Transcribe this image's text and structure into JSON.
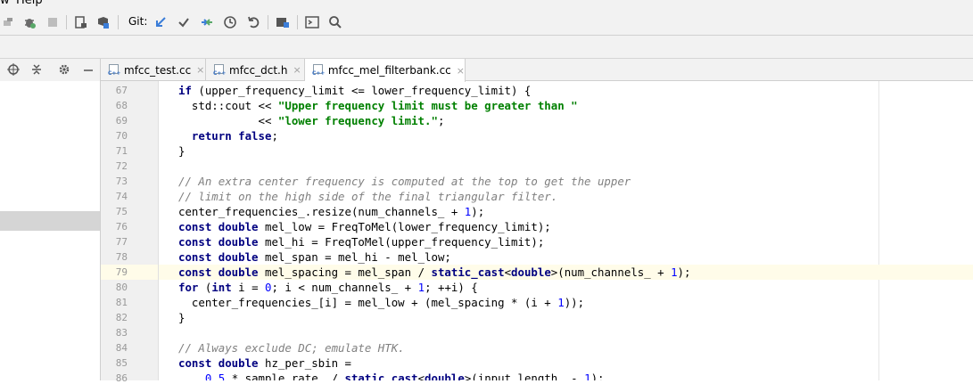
{
  "menu": {
    "view_label": "w",
    "help_label": "Help"
  },
  "toolbar": {
    "git_label": "Git:",
    "icons": [
      "build-icon",
      "debug-icon",
      "stop-icon",
      "run-coverage-icon",
      "profile-icon",
      "git-update-icon",
      "git-commit-icon",
      "git-compare-icon",
      "git-history-icon",
      "git-revert-icon",
      "project-structure-icon",
      "terminal-icon",
      "search-icon"
    ]
  },
  "tabs": [
    {
      "label": "mfcc_test.cc",
      "close": "×",
      "active": false
    },
    {
      "label": "mfcc_dct.h",
      "close": "×",
      "active": false
    },
    {
      "label": "mfcc_mel_filterbank.cc",
      "close": "×",
      "active": true
    }
  ],
  "file_icon_text": "C++",
  "editor": {
    "highlighted_line": "79",
    "lines": [
      {
        "n": "67",
        "tokens": [
          {
            "t": "if",
            "c": "kw"
          },
          {
            "t": " (upper_frequency_limit <= lower_frequency_limit) {",
            "c": ""
          }
        ]
      },
      {
        "n": "68",
        "tokens": [
          {
            "t": "  std::cout << ",
            "c": ""
          },
          {
            "t": "\"Upper frequency limit must be greater than \"",
            "c": "str"
          }
        ]
      },
      {
        "n": "69",
        "tokens": [
          {
            "t": "            << ",
            "c": ""
          },
          {
            "t": "\"lower frequency limit.\"",
            "c": "str"
          },
          {
            "t": ";",
            "c": ""
          }
        ]
      },
      {
        "n": "70",
        "tokens": [
          {
            "t": "  ",
            "c": ""
          },
          {
            "t": "return false",
            "c": "kw"
          },
          {
            "t": ";",
            "c": ""
          }
        ]
      },
      {
        "n": "71",
        "tokens": [
          {
            "t": "}",
            "c": ""
          }
        ]
      },
      {
        "n": "72",
        "tokens": []
      },
      {
        "n": "73",
        "tokens": [
          {
            "t": "// An extra center frequency is computed at the top to get the upper",
            "c": "cm"
          }
        ]
      },
      {
        "n": "74",
        "tokens": [
          {
            "t": "// limit on the high side of the final triangular filter.",
            "c": "cm"
          }
        ]
      },
      {
        "n": "75",
        "tokens": [
          {
            "t": "center_frequencies_.resize(num_channels_ + ",
            "c": ""
          },
          {
            "t": "1",
            "c": "num"
          },
          {
            "t": ");",
            "c": ""
          }
        ]
      },
      {
        "n": "76",
        "tokens": [
          {
            "t": "const double",
            "c": "kw"
          },
          {
            "t": " mel_low = FreqToMel(lower_frequency_limit);",
            "c": ""
          }
        ]
      },
      {
        "n": "77",
        "tokens": [
          {
            "t": "const double",
            "c": "kw"
          },
          {
            "t": " mel_hi = FreqToMel(upper_frequency_limit);",
            "c": ""
          }
        ]
      },
      {
        "n": "78",
        "tokens": [
          {
            "t": "const double",
            "c": "kw"
          },
          {
            "t": " mel_span = mel_hi - mel_low;",
            "c": ""
          }
        ]
      },
      {
        "n": "79",
        "tokens": [
          {
            "t": "const double",
            "c": "kw"
          },
          {
            "t": " mel_spacing = mel_span / ",
            "c": ""
          },
          {
            "t": "static_cast",
            "c": "kw"
          },
          {
            "t": "<",
            "c": ""
          },
          {
            "t": "double",
            "c": "kw"
          },
          {
            "t": ">(num_channels_ + ",
            "c": ""
          },
          {
            "t": "1",
            "c": "num"
          },
          {
            "t": ");",
            "c": ""
          }
        ]
      },
      {
        "n": "80",
        "tokens": [
          {
            "t": "for",
            "c": "kw"
          },
          {
            "t": " (",
            "c": ""
          },
          {
            "t": "int",
            "c": "kw"
          },
          {
            "t": " i = ",
            "c": ""
          },
          {
            "t": "0",
            "c": "num"
          },
          {
            "t": "; i < num_channels_ + ",
            "c": ""
          },
          {
            "t": "1",
            "c": "num"
          },
          {
            "t": "; ++i) {",
            "c": ""
          }
        ]
      },
      {
        "n": "81",
        "tokens": [
          {
            "t": "  center_frequencies_[i] = mel_low + (mel_spacing * (i + ",
            "c": ""
          },
          {
            "t": "1",
            "c": "num"
          },
          {
            "t": "));",
            "c": ""
          }
        ]
      },
      {
        "n": "82",
        "tokens": [
          {
            "t": "}",
            "c": ""
          }
        ]
      },
      {
        "n": "83",
        "tokens": []
      },
      {
        "n": "84",
        "tokens": [
          {
            "t": "// Always exclude DC; emulate HTK.",
            "c": "cm"
          }
        ]
      },
      {
        "n": "85",
        "tokens": [
          {
            "t": "const double",
            "c": "kw"
          },
          {
            "t": " hz_per_sbin =",
            "c": ""
          }
        ]
      },
      {
        "n": "86",
        "tokens": [
          {
            "t": "    ",
            "c": ""
          },
          {
            "t": "0.5",
            "c": "num"
          },
          {
            "t": " * sample_rate_ / ",
            "c": ""
          },
          {
            "t": "static_cast",
            "c": "kw"
          },
          {
            "t": "<",
            "c": ""
          },
          {
            "t": "double",
            "c": "kw"
          },
          {
            "t": ">(input_length_ - ",
            "c": ""
          },
          {
            "t": "1",
            "c": "num"
          },
          {
            "t": ");",
            "c": ""
          }
        ]
      }
    ]
  }
}
